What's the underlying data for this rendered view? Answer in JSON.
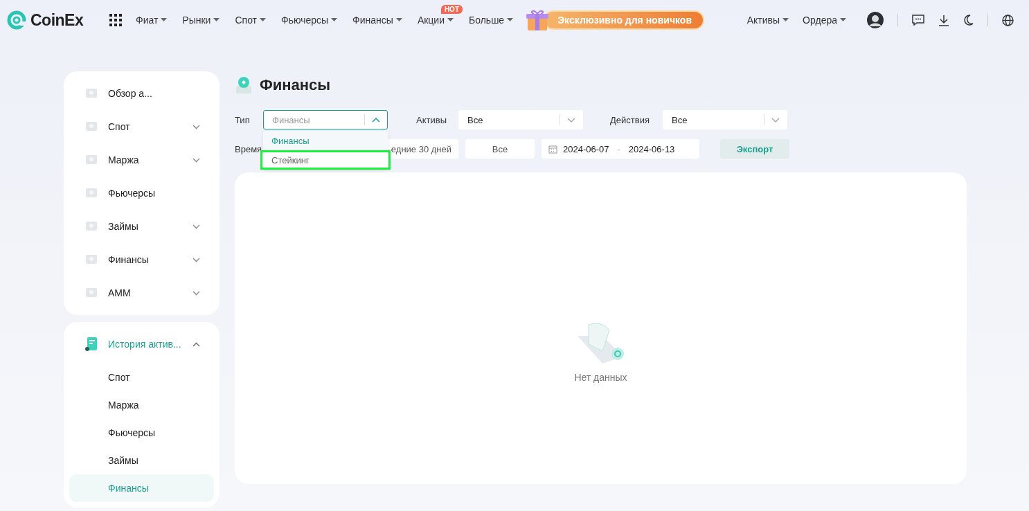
{
  "header": {
    "logo": "CoinEx",
    "nav": [
      {
        "label": "Фиат"
      },
      {
        "label": "Рынки"
      },
      {
        "label": "Спот"
      },
      {
        "label": "Фьючерсы"
      },
      {
        "label": "Финансы"
      },
      {
        "label": "Акции",
        "badge": "HOT"
      },
      {
        "label": "Больше"
      }
    ],
    "promo": "Эксклюзивно для новичков",
    "right_nav": [
      "Активы",
      "Ордера"
    ]
  },
  "sidebar": {
    "items": [
      {
        "label": "Обзор а...",
        "expandable": false
      },
      {
        "label": "Спот",
        "expandable": true
      },
      {
        "label": "Маржа",
        "expandable": true
      },
      {
        "label": "Фьючерсы",
        "expandable": false
      },
      {
        "label": "Займы",
        "expandable": true
      },
      {
        "label": "Финансы",
        "expandable": true
      },
      {
        "label": "AMM",
        "expandable": true
      }
    ],
    "history": {
      "label": "История актив...",
      "expanded": true,
      "children": [
        {
          "label": "Спот",
          "selected": false
        },
        {
          "label": "Маржа",
          "selected": false
        },
        {
          "label": "Фьючерсы",
          "selected": false
        },
        {
          "label": "Займы",
          "selected": false
        },
        {
          "label": "Финансы",
          "selected": true
        }
      ]
    }
  },
  "page": {
    "title": "Финансы",
    "filters": [
      {
        "label": "Тип",
        "value": "Финансы",
        "open": true
      },
      {
        "label": "Активы",
        "value": "Все",
        "open": false
      },
      {
        "label": "Действия",
        "value": "Все",
        "open": false
      }
    ],
    "type_options": [
      {
        "label": "Финансы",
        "selected": true,
        "highlighted": false
      },
      {
        "label": "Стейкинг",
        "selected": false,
        "highlighted": true
      }
    ],
    "time": {
      "label": "Время",
      "range": "едние 30 дней",
      "all": "Все",
      "start": "2024-06-07",
      "separator": "-",
      "end": "2024-06-13"
    },
    "export": "Экспорт",
    "empty": "Нет данных"
  }
}
